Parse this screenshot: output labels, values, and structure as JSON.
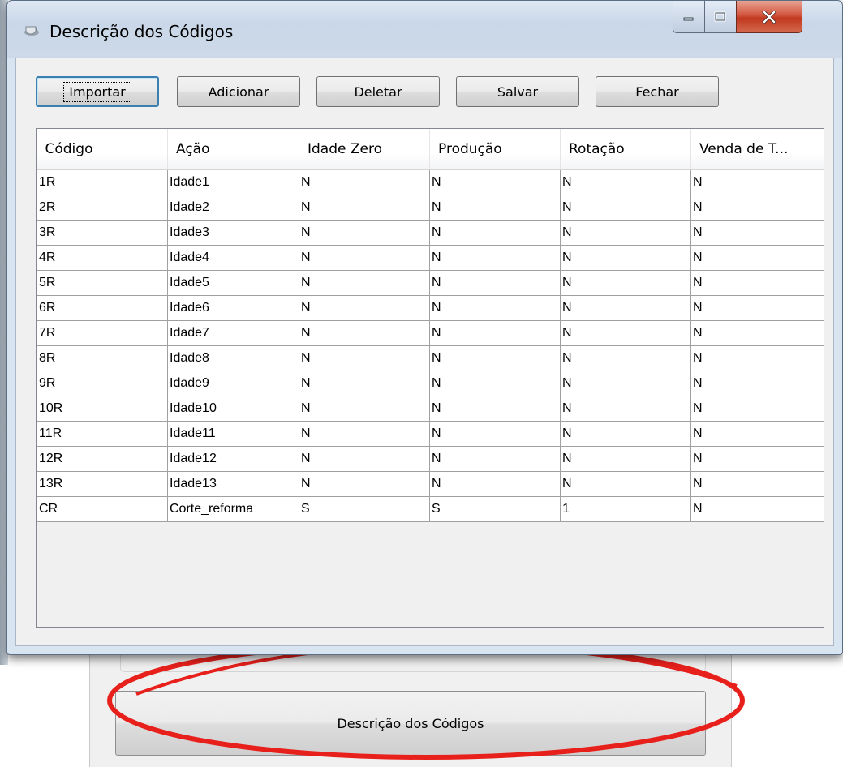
{
  "window": {
    "title": "Descrição dos Códigos"
  },
  "toolbar": {
    "importar": "Importar",
    "adicionar": "Adicionar",
    "deletar": "Deletar",
    "salvar": "Salvar",
    "fechar": "Fechar"
  },
  "table": {
    "headers": [
      "Código",
      "Ação",
      "Idade Zero",
      "Produção",
      "Rotação",
      "Venda de T..."
    ],
    "rows": [
      [
        "1R",
        "Idade1",
        "N",
        "N",
        "N",
        "N"
      ],
      [
        "2R",
        "Idade2",
        "N",
        "N",
        "N",
        "N"
      ],
      [
        "3R",
        "Idade3",
        "N",
        "N",
        "N",
        "N"
      ],
      [
        "4R",
        "Idade4",
        "N",
        "N",
        "N",
        "N"
      ],
      [
        "5R",
        "Idade5",
        "N",
        "N",
        "N",
        "N"
      ],
      [
        "6R",
        "Idade6",
        "N",
        "N",
        "N",
        "N"
      ],
      [
        "7R",
        "Idade7",
        "N",
        "N",
        "N",
        "N"
      ],
      [
        "8R",
        "Idade8",
        "N",
        "N",
        "N",
        "N"
      ],
      [
        "9R",
        "Idade9",
        "N",
        "N",
        "N",
        "N"
      ],
      [
        "10R",
        "Idade10",
        "N",
        "N",
        "N",
        "N"
      ],
      [
        "11R",
        "Idade11",
        "N",
        "N",
        "N",
        "N"
      ],
      [
        "12R",
        "Idade12",
        "N",
        "N",
        "N",
        "N"
      ],
      [
        "13R",
        "Idade13",
        "N",
        "N",
        "N",
        "N"
      ],
      [
        "CR",
        "Corte_reforma",
        "S",
        "S",
        "1",
        "N"
      ]
    ]
  },
  "background": {
    "button_label": "Descrição dos Códigos"
  },
  "colors": {
    "annotation_ellipse": "#e8201c",
    "close_button": "#c9432a",
    "focus_border": "#3c7fb1"
  }
}
